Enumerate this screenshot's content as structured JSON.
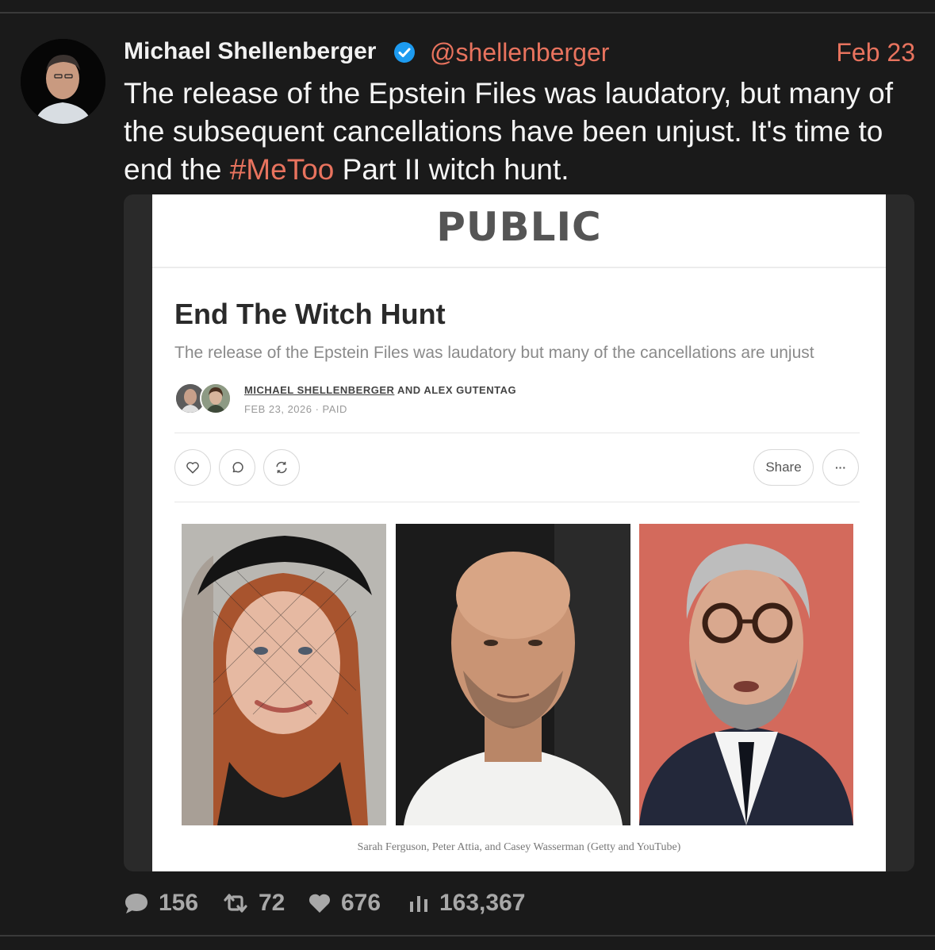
{
  "tweet": {
    "author_name": "Michael Shellenberger",
    "handle": "@shellenberger",
    "date": "Feb 23",
    "text_before": "The release of the Epstein Files was laudatory, but many of the subsequent cancellations have been unjust. It's time to end the ",
    "hashtag": "#MeToo",
    "text_after": " Part II witch hunt."
  },
  "article": {
    "publication": "PUBLIC",
    "title": "End The Witch Hunt",
    "subtitle": "The release of the Epstein Files was laudatory but many of the cancellations are unjust",
    "author1": "MICHAEL SHELLENBERGER",
    "author_conj": " AND ALEX GUTENTAG",
    "meta": "FEB 23, 2026 · PAID",
    "share_label": "Share",
    "more_label": "···",
    "caption": "Sarah Ferguson, Peter Attia, and Casey Wasserman (Getty and YouTube)"
  },
  "stats": {
    "replies": "156",
    "retweets": "72",
    "likes": "676",
    "views": "163,367"
  },
  "colors": {
    "accent": "#e8735e",
    "background": "#1a1a1a",
    "verified": "#1d9bf0"
  }
}
